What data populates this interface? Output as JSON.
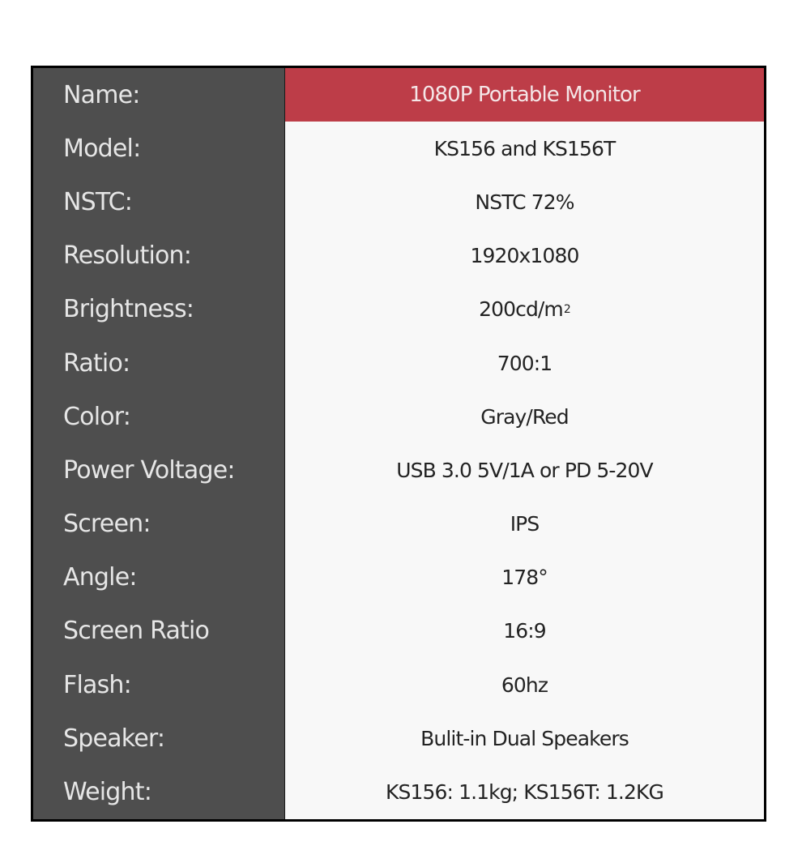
{
  "colors": {
    "label_column_bg": "#4e4e4e",
    "label_text": "#e6e6e6",
    "value_column_bg": "#f8f8f8",
    "value_text": "#232323",
    "highlight_bg": "#bd3d48",
    "highlight_text": "#f4e6e7",
    "border": "#000000"
  },
  "specs": [
    {
      "label": "Name:",
      "value": "1080P Portable Monitor",
      "highlight": true
    },
    {
      "label": "Model:",
      "value": "KS156 and KS156T"
    },
    {
      "label": "NSTC:",
      "value": "NSTC 72%"
    },
    {
      "label": "Resolution:",
      "value": "1920x1080"
    },
    {
      "label": "Brightness:",
      "value": "200cd/m",
      "superscript": "2"
    },
    {
      "label": "Ratio:",
      "value": "700:1"
    },
    {
      "label": "Color:",
      "value": "Gray/Red"
    },
    {
      "label": "Power Voltage:",
      "value": "USB 3.0 5V/1A or PD 5-20V"
    },
    {
      "label": "Screen:",
      "value": "IPS"
    },
    {
      "label": "Angle:",
      "value": "178°"
    },
    {
      "label": "Screen Ratio",
      "value": "16:9"
    },
    {
      "label": "Flash:",
      "value": "60hz"
    },
    {
      "label": "Speaker:",
      "value": "Bulit-in Dual Speakers"
    },
    {
      "label": "Weight:",
      "value": "KS156: 1.1kg; KS156T: 1.2KG"
    }
  ]
}
